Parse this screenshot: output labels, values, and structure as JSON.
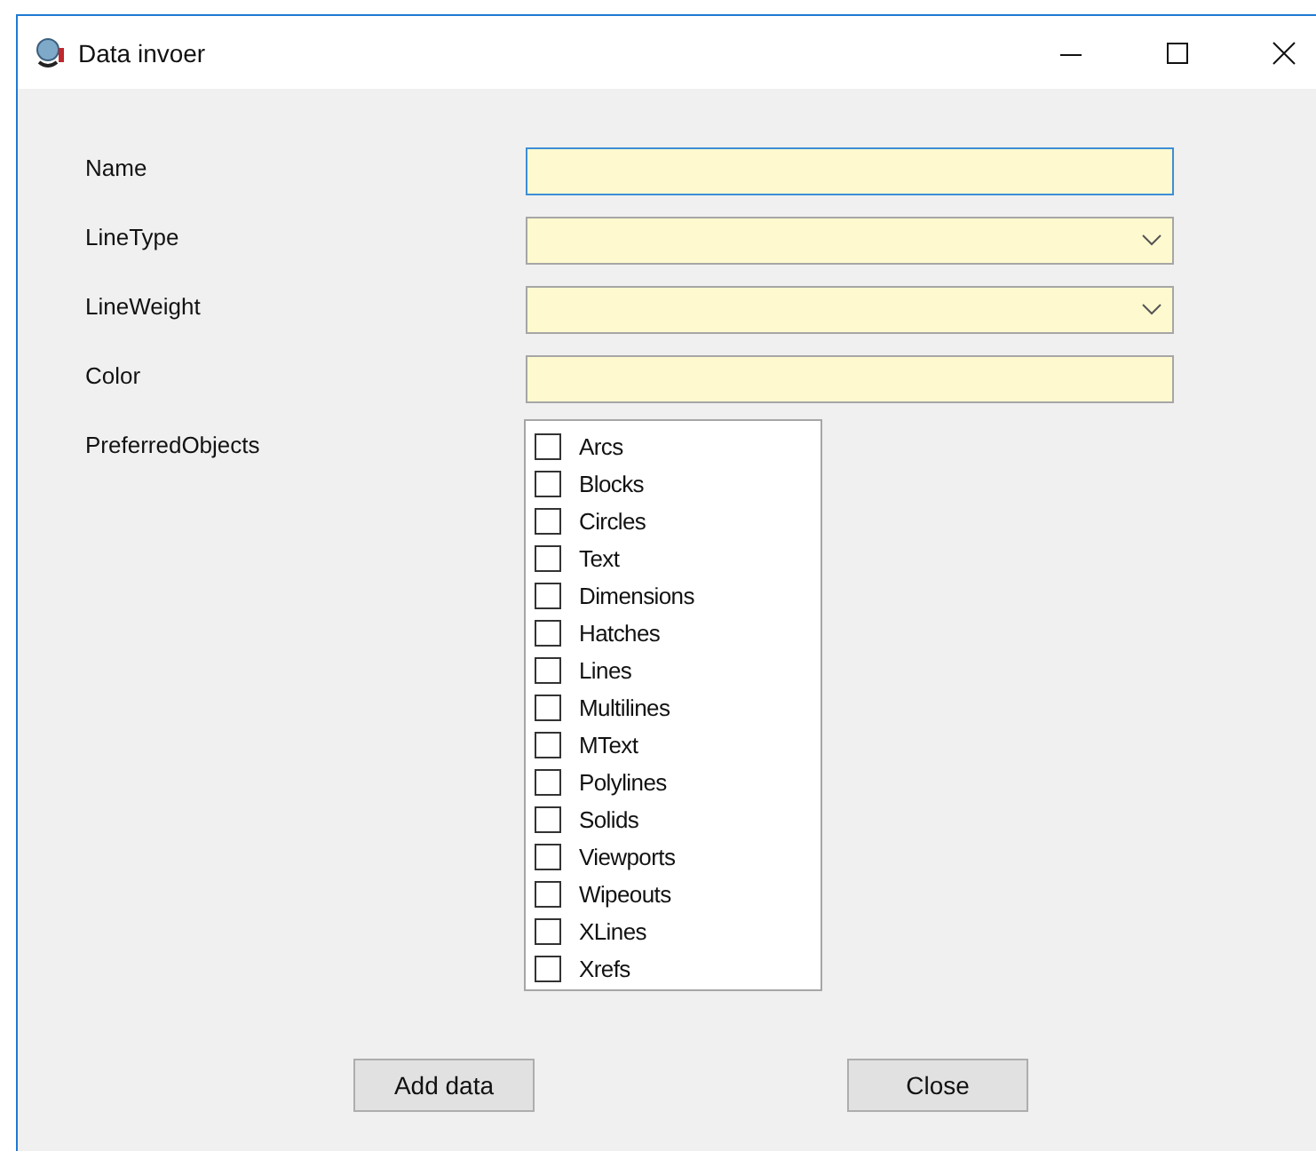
{
  "window": {
    "title": "Data invoer"
  },
  "fields": [
    {
      "label": "Name",
      "kind": "text",
      "focused": true
    },
    {
      "label": "LineType",
      "kind": "combo",
      "focused": false
    },
    {
      "label": "LineWeight",
      "kind": "combo",
      "focused": false
    },
    {
      "label": "Color",
      "kind": "text",
      "focused": false
    }
  ],
  "preferred_objects": {
    "label": "PreferredObjects",
    "items": [
      {
        "label": "Arcs",
        "checked": false
      },
      {
        "label": "Blocks",
        "checked": false
      },
      {
        "label": "Circles",
        "checked": false
      },
      {
        "label": "Text",
        "checked": false
      },
      {
        "label": "Dimensions",
        "checked": false
      },
      {
        "label": "Hatches",
        "checked": false
      },
      {
        "label": "Lines",
        "checked": false
      },
      {
        "label": "Multilines",
        "checked": false
      },
      {
        "label": "MText",
        "checked": false
      },
      {
        "label": "Polylines",
        "checked": false
      },
      {
        "label": "Solids",
        "checked": false
      },
      {
        "label": "Viewports",
        "checked": false
      },
      {
        "label": "Wipeouts",
        "checked": false
      },
      {
        "label": "XLines",
        "checked": false
      },
      {
        "label": "Xrefs",
        "checked": false
      }
    ]
  },
  "buttons": [
    "Add data",
    "Close"
  ]
}
